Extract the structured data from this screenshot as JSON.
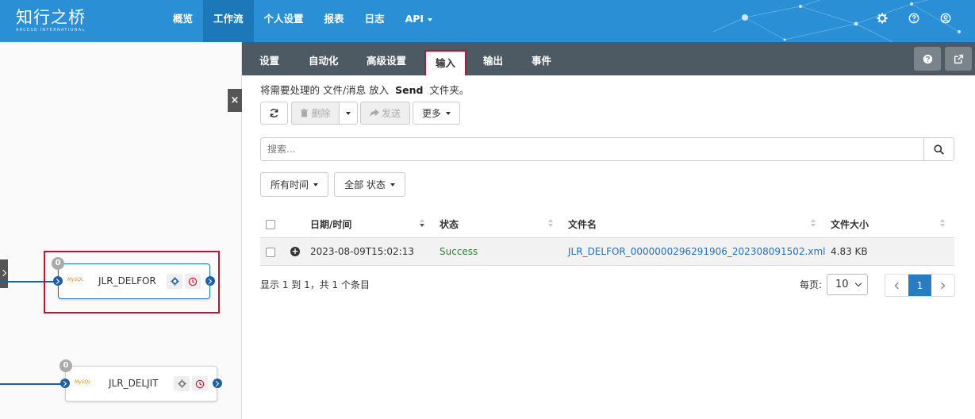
{
  "brand": {
    "name": "知行之桥",
    "sub": "ARCESB INTERNATIONAL"
  },
  "nav": {
    "items": [
      {
        "label": "概览"
      },
      {
        "label": "工作流"
      },
      {
        "label": "个人设置"
      },
      {
        "label": "报表"
      },
      {
        "label": "日志"
      },
      {
        "label": "API"
      }
    ],
    "active": "工作流"
  },
  "header_icons": [
    "gear-icon",
    "help-icon",
    "user-icon"
  ],
  "canvas": {
    "close_label": "×",
    "nodes": [
      {
        "name": "JLR_DELFOR",
        "badge": "0",
        "type": "MySQL",
        "selected": true
      },
      {
        "name": "JLR_DELJIT",
        "badge": "0",
        "type": "MySQL",
        "selected": false
      }
    ]
  },
  "tabs": {
    "items": [
      {
        "label": "设置"
      },
      {
        "label": "自动化"
      },
      {
        "label": "高级设置"
      },
      {
        "label": "输入"
      },
      {
        "label": "输出"
      },
      {
        "label": "事件"
      }
    ],
    "active": "输入"
  },
  "desc": {
    "pre": "将需要处理的 文件/消息 放入",
    "folder": "Send",
    "post": "文件夹。"
  },
  "toolbar": {
    "delete_label": "删除",
    "send_label": "发送",
    "more_label": "更多"
  },
  "search": {
    "placeholder": "搜索..."
  },
  "filters": {
    "time_label": "所有时间",
    "status_label": "全部 状态"
  },
  "table": {
    "columns": [
      "日期/时间",
      "状态",
      "文件名",
      "文件大小"
    ],
    "rows": [
      {
        "datetime": "2023-08-09T15:02:13",
        "status": "Success",
        "filename": "JLR_DELFOR_0000000296291906_202308091502.xml",
        "size": "4.83 KB"
      }
    ]
  },
  "footer": {
    "info": "显示 1 到 1，共 1 个条目",
    "per_page_label": "每页:",
    "per_page": "10",
    "current_page": "1"
  },
  "colors": {
    "header": "#2b8fd6",
    "tabbar": "#4d5963",
    "success": "#2e7d32",
    "link": "#2a6fb0",
    "highlight": "#c8102e"
  }
}
